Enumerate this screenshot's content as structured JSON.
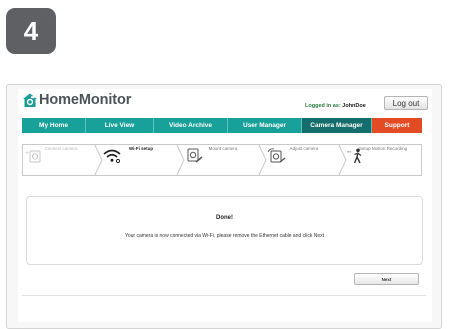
{
  "step_badge": "4",
  "app": {
    "logo_text": "HomeMonitor"
  },
  "header": {
    "logged_in_label": "Logged in as:",
    "username": "JohnDoe",
    "logout_label": "Log out"
  },
  "nav": {
    "items": [
      {
        "label": "My Home"
      },
      {
        "label": "Live View"
      },
      {
        "label": "Video Archive"
      },
      {
        "label": "User Manager"
      },
      {
        "label": "Camera Manager",
        "active": true
      },
      {
        "label": "Support"
      }
    ]
  },
  "wizard": {
    "steps": [
      {
        "label": "Connect camera",
        "icon": "camera-add-icon",
        "state": "done"
      },
      {
        "label": "Wi-Fi setup",
        "icon": "wifi-icon",
        "state": "active"
      },
      {
        "label": "Mount camera",
        "icon": "mount-camera-icon",
        "state": "pending"
      },
      {
        "label": "Adjust camera",
        "icon": "adjust-camera-icon",
        "state": "pending"
      },
      {
        "label": "Setup Motion Recording",
        "icon": "motion-person-icon",
        "state": "pending"
      }
    ]
  },
  "message": {
    "title": "Done!",
    "body": "Your camera is now connected via Wi-Fi, please remove the Ethernet cable and click Next"
  },
  "actions": {
    "next_label": "Next"
  },
  "colors": {
    "nav_teal": "#18a09a",
    "nav_active": "#136e6b",
    "support_orange": "#e34b24",
    "brand_text": "#4d5458"
  }
}
